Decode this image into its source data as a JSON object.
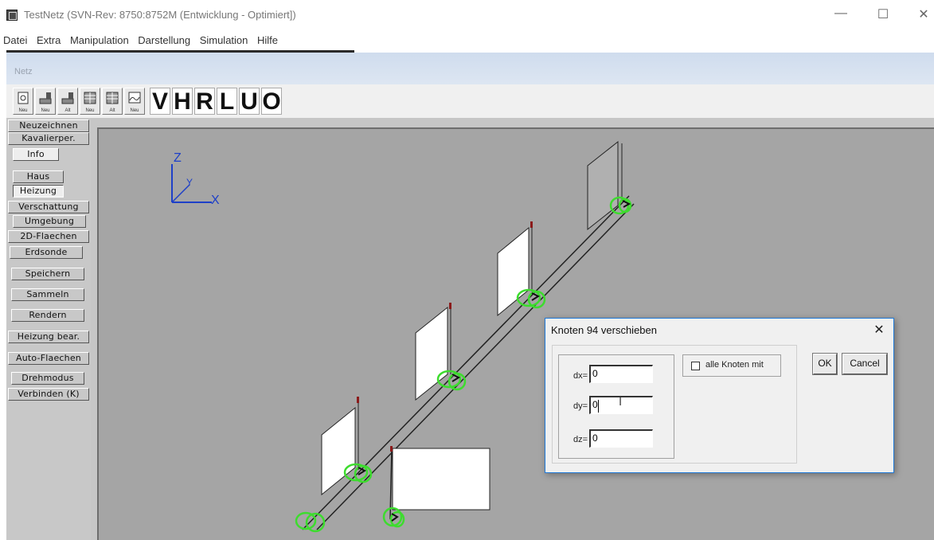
{
  "window": {
    "title": "TestNetz (SVN-Rev: 8750:8752M (Entwicklung - Optimiert])",
    "minimize": "—",
    "maximize": "☐",
    "close": "✕"
  },
  "menu": [
    "Datei",
    "Extra",
    "Manipulation",
    "Darstellung",
    "Simulation",
    "Hilfe"
  ],
  "panel": {
    "title": "Netz"
  },
  "toolbar": {
    "icon_buttons": [
      {
        "icon": "new-net-icon",
        "label": "Neu"
      },
      {
        "icon": "new-wall-icon",
        "label": "Neu"
      },
      {
        "icon": "old-wall-icon",
        "label": "Alt"
      },
      {
        "icon": "new-brick-icon",
        "label": "Neu"
      },
      {
        "icon": "old-brick-icon",
        "label": "Alt"
      },
      {
        "icon": "new-radiator-icon",
        "label": "Neu"
      }
    ],
    "view_letters": [
      "V",
      "H",
      "R",
      "L",
      "U",
      "O"
    ]
  },
  "sidebar": {
    "buttons": [
      "Neuzeichnen",
      "Kavalierper.",
      "Info",
      "Haus",
      "Heizung",
      "Verschattung",
      "Umgebung",
      "2D-Flaechen",
      "Erdsonde",
      "Speichern",
      "Sammeln",
      "Rendern",
      "Heizung bear.",
      "Auto-Flaechen",
      "Drehmodus",
      "Verbinden (K)"
    ]
  },
  "axes": {
    "z": "Z",
    "y": "Y",
    "x": "X"
  },
  "dialog": {
    "title": "Knoten  94 verschieben",
    "close": "✕",
    "fields": [
      {
        "label": "dx=",
        "value": "0"
      },
      {
        "label": "dy=",
        "value": "0"
      },
      {
        "label": "dz=",
        "value": "0"
      }
    ],
    "checkbox_label": "alle Knoten mit",
    "checkbox_checked": false,
    "ok_label": "OK",
    "cancel_label": "Cancel"
  },
  "colors": {
    "viewport": "#a5a5a5",
    "node_highlight": "#3ddc2e",
    "axis": "#1e40c8"
  }
}
